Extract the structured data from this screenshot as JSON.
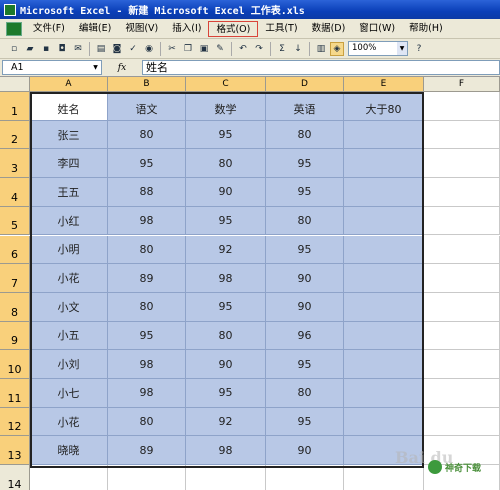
{
  "window": {
    "title": "Microsoft Excel - 新建 Microsoft Excel 工作表.xls"
  },
  "menu": [
    "文件(F)",
    "编辑(E)",
    "视图(V)",
    "插入(I)",
    "格式(O)",
    "工具(T)",
    "数据(D)",
    "窗口(W)",
    "帮助(H)"
  ],
  "menu_highlighted": "格式(O)",
  "toolbar": {
    "zoom": "100%"
  },
  "formula_bar": {
    "name_box": "A1",
    "fx": "fx",
    "value": "姓名"
  },
  "columns": [
    "A",
    "B",
    "C",
    "D",
    "E",
    "F"
  ],
  "rows": [
    "1",
    "2",
    "3",
    "4",
    "5",
    "6",
    "7",
    "8",
    "9",
    "10",
    "11",
    "12",
    "13",
    "14"
  ],
  "table": {
    "headers": [
      "姓名",
      "语文",
      "数学",
      "英语",
      "大于80"
    ],
    "data": [
      [
        "张三",
        "80",
        "95",
        "80",
        ""
      ],
      [
        "李四",
        "95",
        "80",
        "95",
        ""
      ],
      [
        "王五",
        "88",
        "90",
        "95",
        ""
      ],
      [
        "小红",
        "98",
        "95",
        "80",
        ""
      ],
      [
        "小明",
        "80",
        "92",
        "95",
        ""
      ],
      [
        "小花",
        "89",
        "98",
        "90",
        ""
      ],
      [
        "小文",
        "80",
        "95",
        "90",
        ""
      ],
      [
        "小五",
        "95",
        "80",
        "96",
        ""
      ],
      [
        "小刘",
        "98",
        "90",
        "95",
        ""
      ],
      [
        "小七",
        "98",
        "95",
        "80",
        ""
      ],
      [
        "小花",
        "80",
        "92",
        "95",
        ""
      ],
      [
        "晓晓",
        "89",
        "98",
        "90",
        ""
      ]
    ]
  },
  "watermark": {
    "baidu": "Bai du",
    "site": "神奇下载"
  },
  "colors": {
    "title_bar": "#0a3fb8",
    "selection_fill": "#b8c8e6",
    "header_selected": "#f9d07b",
    "chrome": "#ece9d8"
  }
}
